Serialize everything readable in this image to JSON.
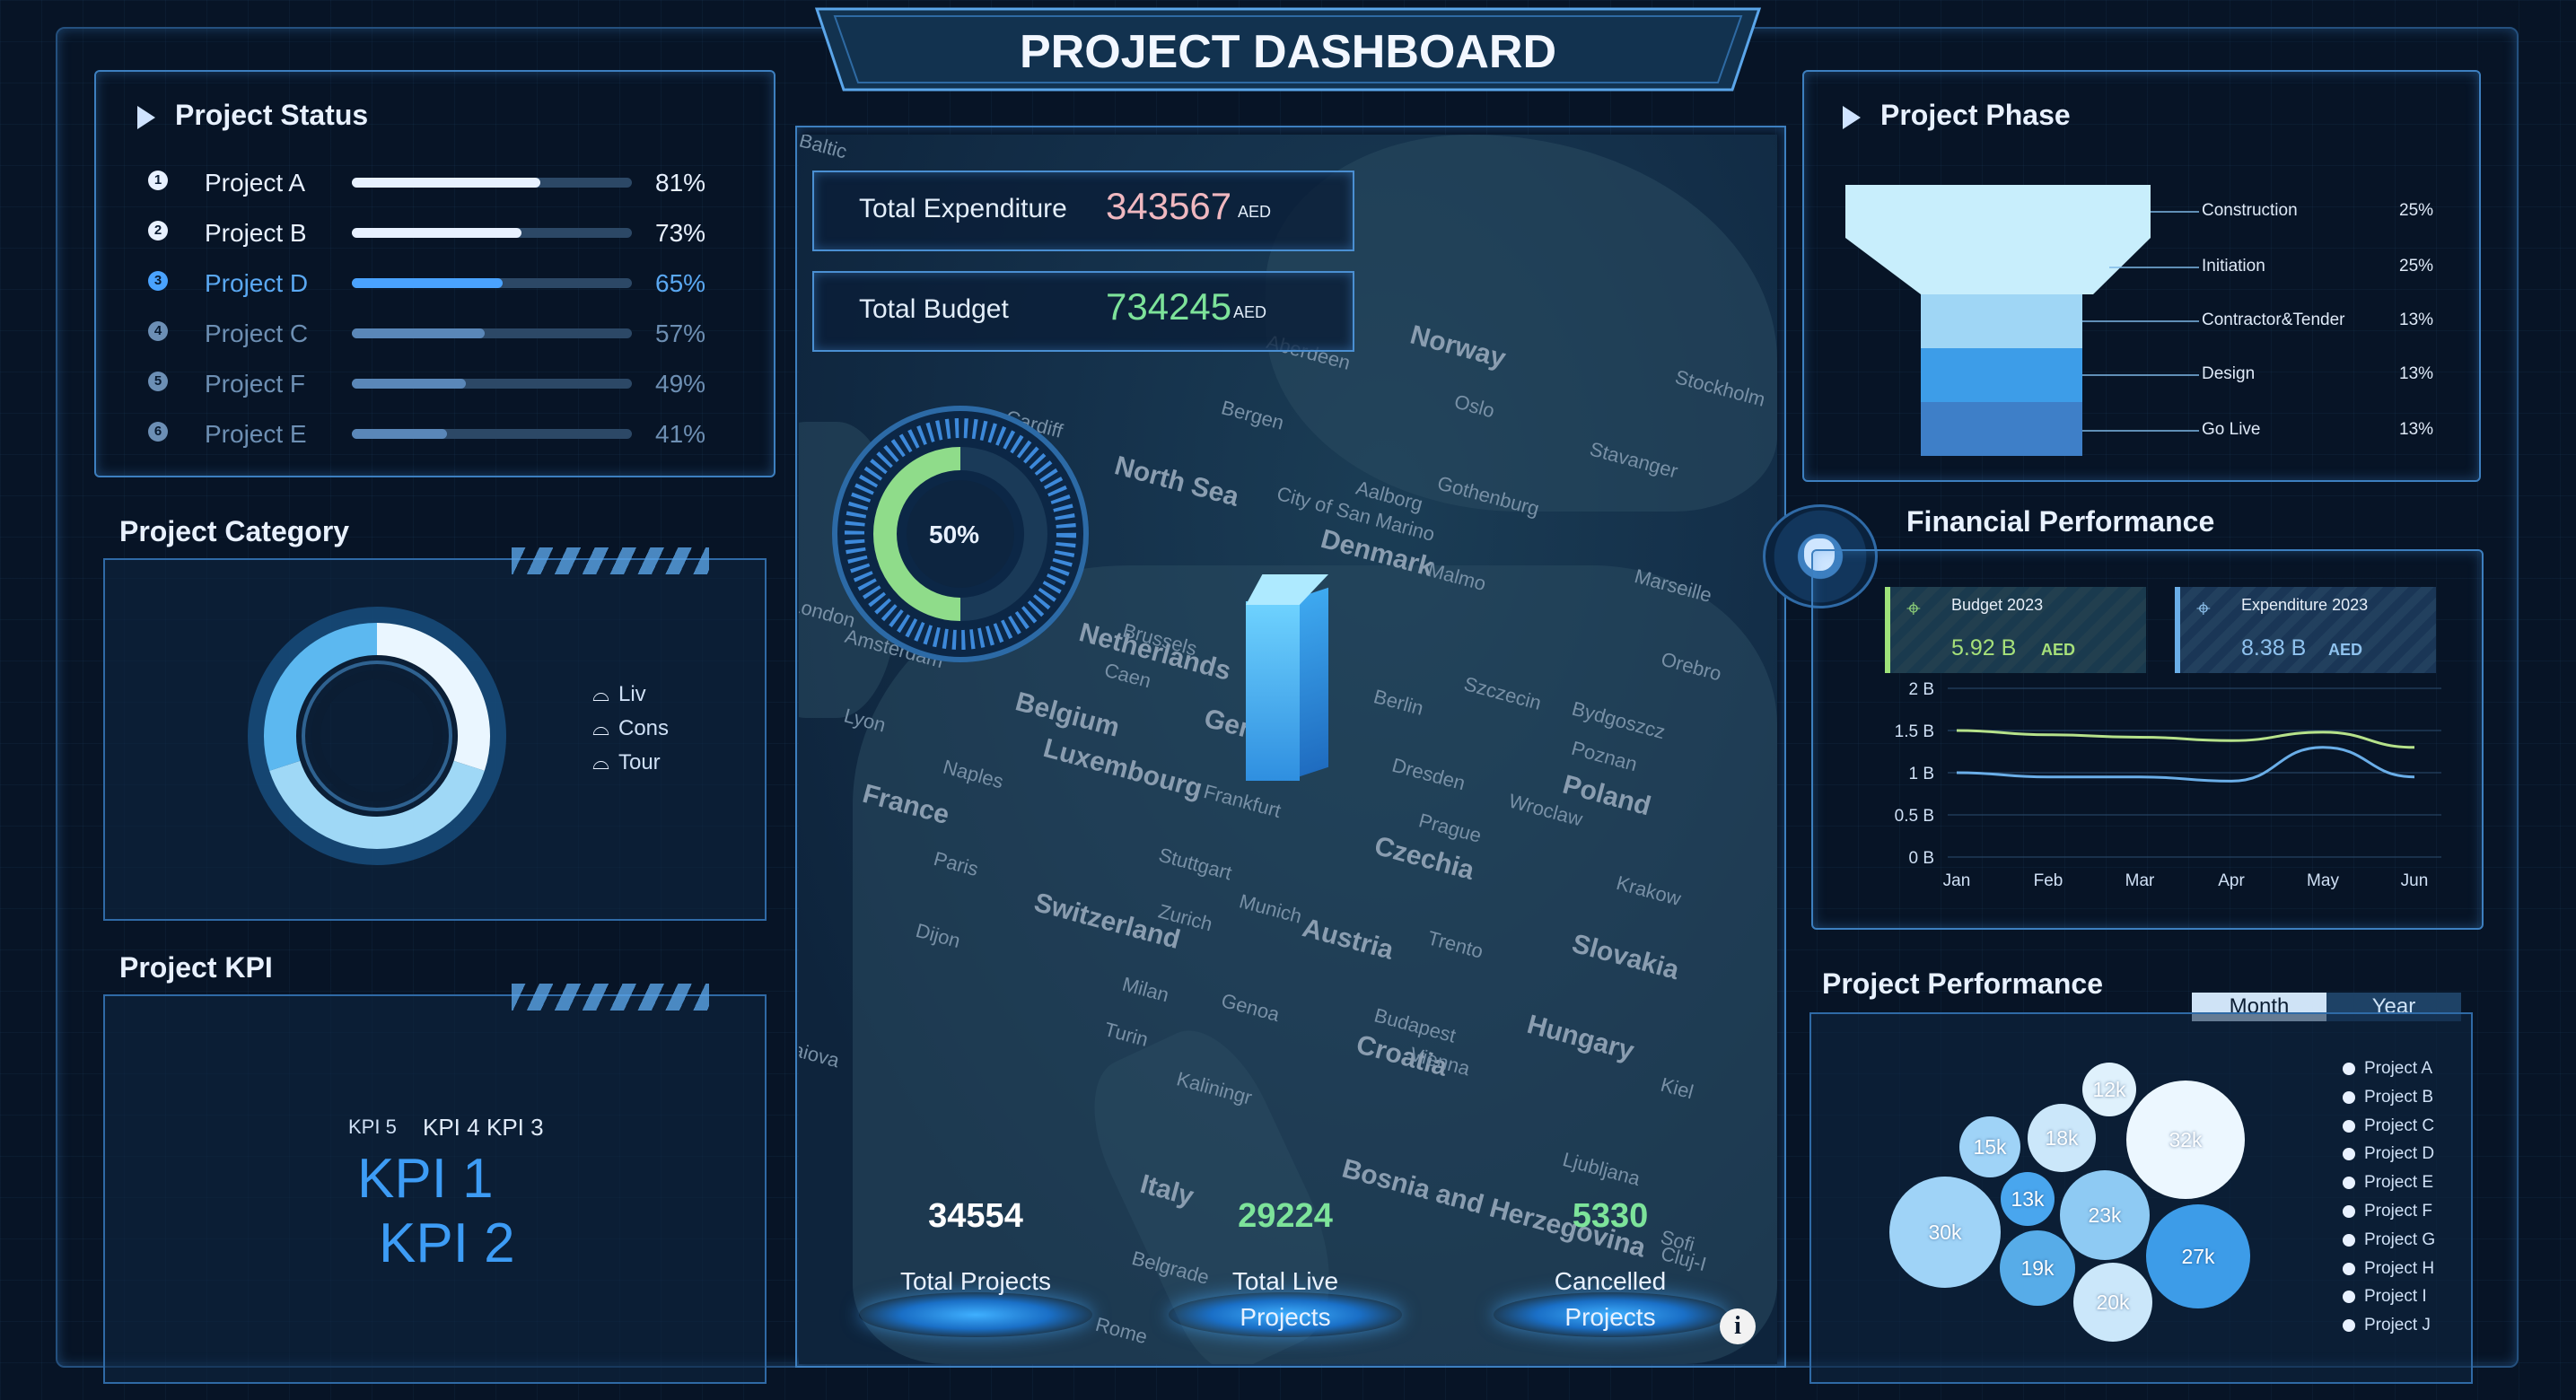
{
  "header": {
    "title": "PROJECT DASHBOARD"
  },
  "project_status": {
    "title": "Project Status",
    "items": [
      {
        "num": "1",
        "name": "Project A",
        "value": 81,
        "label": "81%"
      },
      {
        "num": "2",
        "name": "Project B",
        "value": 73,
        "label": "73%"
      },
      {
        "num": "3",
        "name": "Project D",
        "value": 65,
        "label": "65%"
      },
      {
        "num": "4",
        "name": "Project C",
        "value": 57,
        "label": "57%"
      },
      {
        "num": "5",
        "name": "Project F",
        "value": 49,
        "label": "49%"
      },
      {
        "num": "6",
        "name": "Project E",
        "value": 41,
        "label": "41%"
      }
    ]
  },
  "project_category": {
    "title": "Project Category",
    "legend": [
      "Liv",
      "Cons",
      "Tour"
    ]
  },
  "project_kpi": {
    "title": "Project KPI",
    "words": [
      "KPI 5",
      "KPI 4",
      "KPI 3",
      "KPI 1",
      "KPI 2"
    ]
  },
  "center": {
    "total_expenditure": {
      "label": "Total Expenditure",
      "value": "343567",
      "unit": "AED"
    },
    "total_budget": {
      "label": "Total Budget",
      "value": "734245",
      "unit": "AED"
    },
    "gauge": {
      "label": "50%",
      "value": 50
    },
    "stats": [
      {
        "value": "34554",
        "label": "Total Projects"
      },
      {
        "value": "29224",
        "label": "Total Live Projects"
      },
      {
        "value": "5330",
        "label": "Cancelled Projects"
      }
    ],
    "map_places": {
      "countries": [
        "Norway",
        "Denmark",
        "Netherlands",
        "Belgium",
        "Luxembourg",
        "France",
        "Switzerland",
        "Austria",
        "Czechia",
        "Poland",
        "Slovakia",
        "Hungary",
        "Croatia",
        "Italy",
        "Bosnia and Herzegovina",
        "Germany",
        "North Sea"
      ],
      "cities": [
        "Oslo",
        "Stockholm",
        "Aalborg",
        "Gothenburg",
        "Malmo",
        "Berlin",
        "Szczecin",
        "Bydgoszcz",
        "Poznan",
        "Dresden",
        "Prague",
        "Wroclaw",
        "Krakow",
        "Frankfurt",
        "Stuttgart",
        "Munich",
        "Zurich",
        "Milan",
        "Turin",
        "Genoa",
        "Trento",
        "Vienna",
        "Budapest",
        "Ljubljana",
        "Belgrade",
        "Rome",
        "Naples",
        "Paris",
        "Dijon",
        "Lyon",
        "Caen",
        "Brussels",
        "Amsterdam",
        "London",
        "Cardiff",
        "Aberdeen",
        "Bergen",
        "Stavanger",
        "Orebro",
        "Kaliningr",
        "City of San Marino",
        "Kiel",
        "Cluj-I",
        "Sofi",
        "Craiova",
        "Marseille",
        "Baltic"
      ]
    }
  },
  "project_phase": {
    "title": "Project Phase",
    "stages": [
      {
        "name": "Construction",
        "value": "25%"
      },
      {
        "name": "Initiation",
        "value": "25%"
      },
      {
        "name": "Contractor&Tender",
        "value": "13%"
      },
      {
        "name": "Design",
        "value": "13%"
      },
      {
        "name": "Go Live",
        "value": "13%"
      }
    ]
  },
  "financial_performance": {
    "title": "Financial Performance",
    "budget_card": {
      "label": "Budget 2023",
      "value": "5.92 B",
      "unit": "AED"
    },
    "expenditure_card": {
      "label": "Expenditure 2023",
      "value": "8.38 B",
      "unit": "AED"
    }
  },
  "project_performance": {
    "title": "Project Performance",
    "tabs": [
      "Month",
      "Year"
    ],
    "active_tab": "Month",
    "legend": [
      "Project A",
      "Project B",
      "Project C",
      "Project D",
      "Project E",
      "Project F",
      "Project G",
      "Project H",
      "Project I",
      "Project J"
    ],
    "bubbles": [
      "12k",
      "18k",
      "15k",
      "32k",
      "13k",
      "23k",
      "30k",
      "27k",
      "19k",
      "20k"
    ]
  },
  "colors": {
    "accent": "#4aa3ff",
    "green": "#7de39a",
    "pink": "#f0b8c0",
    "frame": "#3d7fbf"
  },
  "chart_data": [
    {
      "type": "line",
      "x": [
        "Jan",
        "Feb",
        "Mar",
        "Apr",
        "May",
        "Jun"
      ],
      "ylim": [
        0,
        2
      ],
      "yticks": [
        "2 B",
        "1.5 B",
        "1 B",
        "0.5 B",
        "0 B"
      ],
      "series": [
        {
          "values": [
            1.5,
            1.45,
            1.42,
            1.38,
            1.48,
            1.3
          ],
          "color": "#b6e28a"
        },
        {
          "values": [
            1.0,
            0.95,
            0.95,
            0.9,
            1.3,
            0.95
          ],
          "color": "#6aaee8"
        }
      ]
    },
    {
      "type": "pie",
      "categories": [
        "Liv",
        "Cons",
        "Tour"
      ],
      "values": [
        30,
        40,
        30
      ]
    }
  ]
}
